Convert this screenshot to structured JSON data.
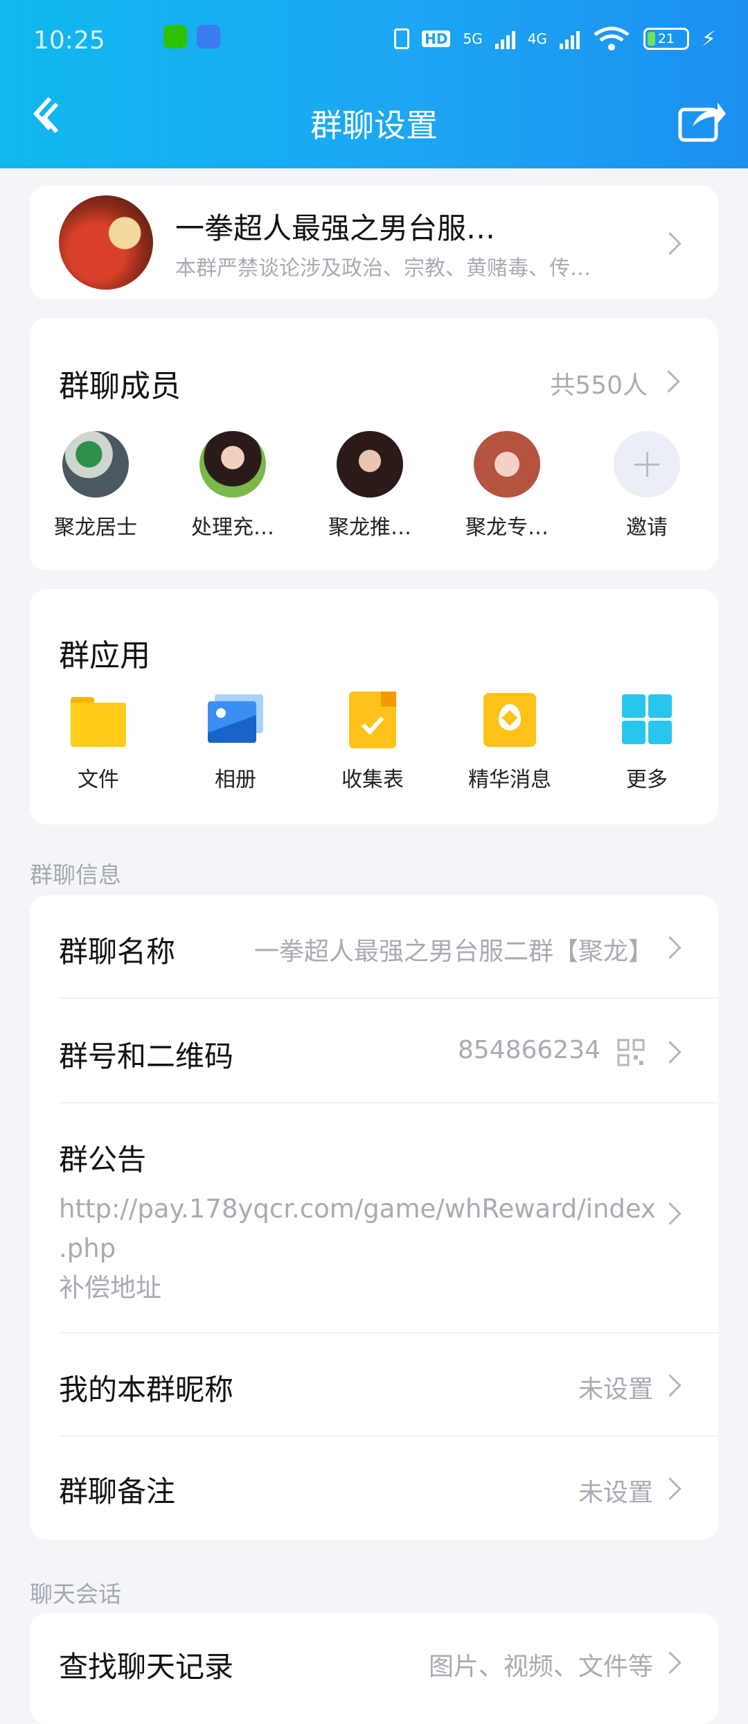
{
  "status_bar": {
    "time": "10:25",
    "network_5g": "5G",
    "network_4g": "4G",
    "hd_label": "HD",
    "battery_level": "21",
    "battery_fraction": 0.21,
    "icons": [
      "wechat-icon",
      "message-icon",
      "vibrate-icon",
      "hd-icon",
      "signal-icon",
      "wifi-icon",
      "battery-icon",
      "charging-icon"
    ]
  },
  "header": {
    "title": "群聊设置",
    "back_icon": "back-chevron-icon",
    "share_icon": "share-icon"
  },
  "group": {
    "name": "一拳超人最强之男台服…",
    "description": "本群严禁谈论涉及政治、宗教、黄赌毒、传…"
  },
  "members": {
    "title": "群聊成员",
    "count": "共550人",
    "list": [
      {
        "name": "聚龙居士"
      },
      {
        "name": "处理充…"
      },
      {
        "name": "聚龙推…"
      },
      {
        "name": "聚龙专…"
      }
    ],
    "invite_label": "邀请"
  },
  "apps": {
    "title": "群应用",
    "items": [
      {
        "label": "文件",
        "icon": "folder-icon"
      },
      {
        "label": "相册",
        "icon": "album-icon"
      },
      {
        "label": "收集表",
        "icon": "form-icon"
      },
      {
        "label": "精华消息",
        "icon": "essence-icon"
      },
      {
        "label": "更多",
        "icon": "more-grid-icon"
      }
    ]
  },
  "info": {
    "caption": "群聊信息",
    "name_label": "群聊名称",
    "name_value": "一拳超人最强之男台服二群【聚龙】",
    "id_label": "群号和二维码",
    "id_value": "854866234",
    "notice_label": "群公告",
    "notice_line1": "http://pay.178yqcr.com/game/whReward/index",
    "notice_line2": ".php",
    "notice_line3": "补偿地址",
    "nickname_label": "我的本群昵称",
    "nickname_value": "未设置",
    "remark_label": "群聊备注",
    "remark_value": "未设置"
  },
  "chat": {
    "caption": "聊天会话",
    "search_label": "查找聊天记录",
    "search_value": "图片、视频、文件等"
  },
  "colors": {
    "header_start": "#10b8ee",
    "header_end": "#1b90f1",
    "background": "#f4f5f9"
  }
}
